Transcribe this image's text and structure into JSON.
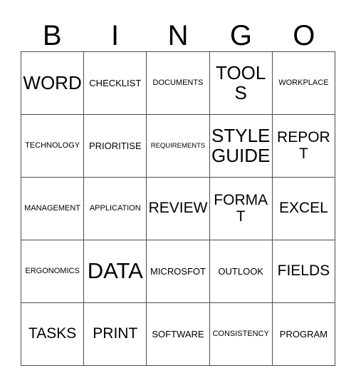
{
  "card": {
    "title": "BINGO",
    "header_letters": [
      "B",
      "I",
      "N",
      "G",
      "O"
    ],
    "grid_rows": [
      [
        {
          "text": "WORD",
          "size": "lg"
        },
        {
          "text": "CHECKLIST",
          "size": "sm"
        },
        {
          "text": "DOCUMENTS",
          "size": "xs"
        },
        {
          "text": "TOOLS",
          "size": "lg"
        },
        {
          "text": "WORKPLACE",
          "size": "xs"
        }
      ],
      [
        {
          "text": "TECHNOLOGY",
          "size": "xs"
        },
        {
          "text": "PRIORITISE",
          "size": "sm"
        },
        {
          "text": "REQUIREMENTS",
          "size": "xxs"
        },
        {
          "text": "STYLE GUIDE",
          "size": "lg"
        },
        {
          "text": "REPORT",
          "size": "md"
        }
      ],
      [
        {
          "text": "MANAGEMENT",
          "size": "xs"
        },
        {
          "text": "APPLICATION",
          "size": "xs"
        },
        {
          "text": "REVIEW",
          "size": "md"
        },
        {
          "text": "FORMAT",
          "size": "md"
        },
        {
          "text": "EXCEL",
          "size": "md"
        }
      ],
      [
        {
          "text": "ERGONOMICS",
          "size": "xs"
        },
        {
          "text": "DATA",
          "size": "xl"
        },
        {
          "text": "MICROSFOT",
          "size": "sm"
        },
        {
          "text": "OUTLOOK",
          "size": "sm"
        },
        {
          "text": "FIELDS",
          "size": "md"
        }
      ],
      [
        {
          "text": "TASKS",
          "size": "md"
        },
        {
          "text": "PRINT",
          "size": "md"
        },
        {
          "text": "SOFTWARE",
          "size": "sm"
        },
        {
          "text": "CONSISTENCY",
          "size": "xs"
        },
        {
          "text": "PROGRAM",
          "size": "sm"
        }
      ]
    ],
    "colors": {
      "background": "#ffffff",
      "text": "#000000",
      "border": "#4d4d4d"
    }
  }
}
